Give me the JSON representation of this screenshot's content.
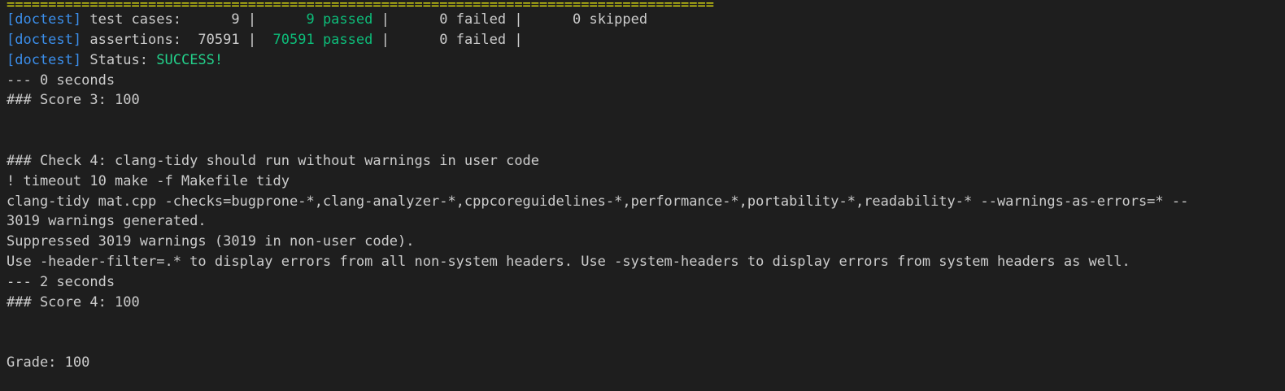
{
  "separator": "=====================================================================================",
  "doctest_prefix": "[doctest]",
  "doctest": {
    "cases_label": " test cases:      9 | ",
    "cases_passed": "     9 passed",
    "cases_rest": " |      0 failed |      0 skipped",
    "assert_label": " assertions:  70591 | ",
    "assert_passed": " 70591 passed",
    "assert_rest": " |      0 failed |",
    "status_label": " Status: ",
    "status_value": "SUCCESS!"
  },
  "lines": {
    "time1": "--- 0 seconds",
    "score3": "### Score 3: 100",
    "check4": "### Check 4: clang-tidy should run without warnings in user code",
    "cmd": "! timeout 10 make -f Makefile tidy",
    "tidy_cmd": "clang-tidy mat.cpp -checks=bugprone-*,clang-analyzer-*,cppcoreguidelines-*,performance-*,portability-*,readability-* --warnings-as-errors=* --",
    "warnings": "3019 warnings generated.",
    "suppressed": "Suppressed 3019 warnings (3019 in non-user code).",
    "hint": "Use -header-filter=.* to display errors from all non-system headers. Use -system-headers to display errors from system headers as well.",
    "time2": "--- 2 seconds",
    "score4": "### Score 4: 100",
    "grade": "Grade: 100"
  },
  "colors": {
    "background": "#1e1e1e",
    "text": "#cccccc",
    "separator": "#e5e510",
    "tag": "#3b8eea",
    "success": "#23d18b"
  }
}
